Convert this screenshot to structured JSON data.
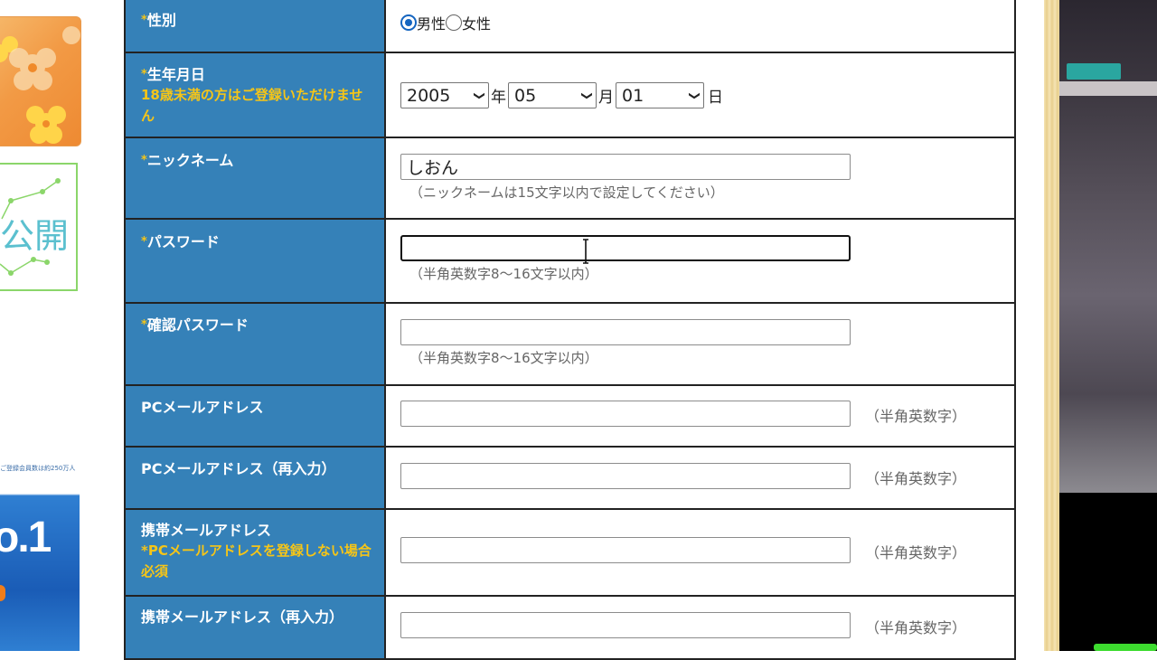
{
  "banners": {
    "public_text": "公開",
    "no1_small": "ご登録会員数は約250万人",
    "no1_big": "o.1"
  },
  "form": {
    "gender": {
      "label": "性別",
      "required_mark": "*",
      "options": [
        "男性",
        "女性"
      ],
      "selected": "男性"
    },
    "birthdate": {
      "label": "生年月日",
      "required_mark": "*",
      "note": "18歳未満の方はご登録いただけません",
      "year": "2005",
      "year_unit": "年",
      "month": "05",
      "month_unit": "月",
      "day": "01",
      "day_unit": "日"
    },
    "nickname": {
      "label": "ニックネーム",
      "required_mark": "*",
      "value": "しおん",
      "hint": "（ニックネームは15文字以内で設定してください）"
    },
    "password": {
      "label": "パスワード",
      "required_mark": "*",
      "value": "",
      "hint": "（半角英数字8～16文字以内）"
    },
    "password_confirm": {
      "label": "確認パスワード",
      "required_mark": "*",
      "value": "",
      "hint": "（半角英数字8～16文字以内）"
    },
    "pc_email": {
      "label": "PCメールアドレス",
      "value": "",
      "hint": "（半角英数字）"
    },
    "pc_email_confirm": {
      "label": "PCメールアドレス（再入力）",
      "value": "",
      "hint": "（半角英数字）"
    },
    "mobile_email": {
      "label": "携帯メールアドレス",
      "note": "*PCメールアドレスを登録しない場合必須",
      "value": "",
      "hint": "（半角英数字）"
    },
    "mobile_email_confirm": {
      "label": "携帯メールアドレス（再入力）",
      "value": "",
      "hint": "（半角英数字）"
    }
  },
  "colors": {
    "label_bg": "#3581b8",
    "required": "#f5c518",
    "radio_checked": "#1565c0"
  }
}
